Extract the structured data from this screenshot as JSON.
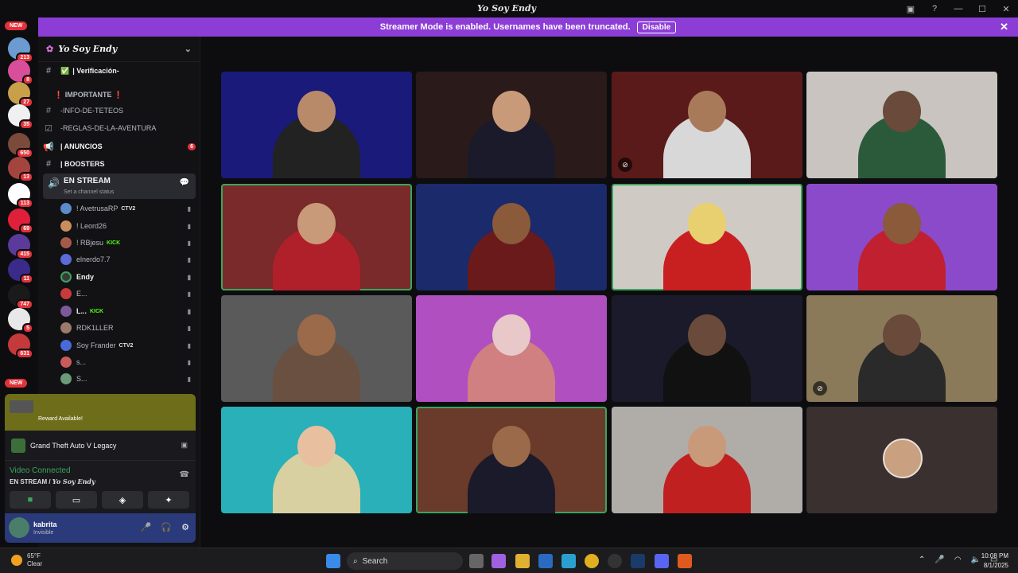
{
  "window": {
    "title": "Yo Soy Endy",
    "controls": [
      "inbox-icon",
      "help-icon",
      "minimize",
      "maximize",
      "close"
    ]
  },
  "banner": {
    "text": "Streamer Mode is enabled. Usernames have been truncated.",
    "button": "Disable"
  },
  "servers": [
    {
      "badge": "213"
    },
    {
      "badge": "8"
    },
    {
      "badge": "27"
    },
    {
      "badge": "35"
    },
    {
      "badge": "650"
    },
    {
      "badge": "13"
    },
    {
      "badge": "113"
    },
    {
      "badge": "69"
    },
    {
      "badge": "415"
    },
    {
      "badge": "11"
    },
    {
      "badge": "747"
    },
    {
      "badge": "5"
    },
    {
      "badge": "631"
    }
  ],
  "new_label": "NEW",
  "guild": {
    "name": "Yo Soy Endy"
  },
  "channels": {
    "verificacion": "| Verificación-",
    "importante": "❗ IMPORTANTE ❗",
    "info": "-INFO-DE-TETEOS",
    "reglas": "-REGLAS-DE-LA-AVENTURA",
    "anuncios": "| ANUNCIOS",
    "anuncios_count": "6",
    "boosters": "| BOOSTERS",
    "voice_name": "EN STREAM",
    "voice_status": "Set a channel status"
  },
  "voice_users": [
    {
      "name": "! AvetrusaRP",
      "tag": "CTV2"
    },
    {
      "name": "! Leord26",
      "tag": ""
    },
    {
      "name": "! RBjesu",
      "tag": "KICK"
    },
    {
      "name": "elnerdo7.7",
      "tag": ""
    },
    {
      "name": "Endy",
      "tag": ""
    },
    {
      "name": "E...",
      "tag": ""
    },
    {
      "name": "L...",
      "tag": "KICK"
    },
    {
      "name": "RDK1LLER",
      "tag": ""
    },
    {
      "name": "Soy Frander",
      "tag": "CTV2"
    },
    {
      "name": "s...",
      "tag": ""
    },
    {
      "name": "S...",
      "tag": ""
    }
  ],
  "reward": {
    "text": "Reward Available!"
  },
  "game": {
    "name": "Grand Theft Auto V Legacy"
  },
  "voice": {
    "connected": "Video Connected",
    "channel": "EN STREAM",
    "server": "Yo Soy Endy"
  },
  "user": {
    "name": "kabrita",
    "status": "Invisible"
  },
  "taskbar": {
    "temp": "65°F",
    "weather": "Clear",
    "search": "Search",
    "time": "10:08 PM",
    "date": "8/1/2025"
  }
}
